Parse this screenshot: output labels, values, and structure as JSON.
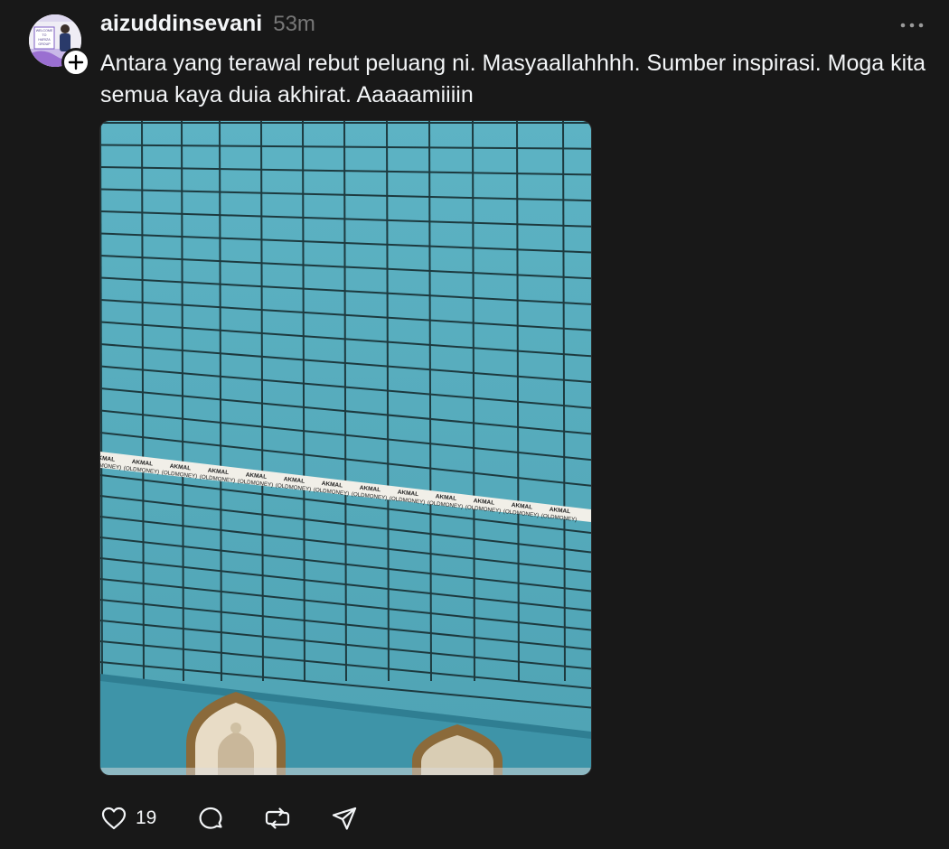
{
  "post": {
    "username": "aizuddinsevani",
    "timestamp": "53m",
    "caption": "Antara yang terawal rebut peluang ni. Masyaallahhhh. Sumber inspirasi. Moga kita semua kaya duia akhirat. Aaaaamiiiin",
    "avatar_text": {
      "line1": "WELCOME",
      "line2": "TO",
      "line3": "HARIZA",
      "line4": "GROUP"
    },
    "media": {
      "label_name": "AKMAL",
      "label_sub": "(OLDMONEY)",
      "label_count_visible": 13
    }
  },
  "actions": {
    "like_icon": "heart-icon",
    "like_count": "19",
    "comment_icon": "comment-icon",
    "repost_icon": "repost-icon",
    "share_icon": "send-icon"
  },
  "menu": {
    "more_icon": "more-horizontal-icon"
  },
  "colors": {
    "background": "#181818",
    "text_primary": "#f3f5f7",
    "text_secondary": "#777777",
    "tile": "#5aaebf"
  }
}
